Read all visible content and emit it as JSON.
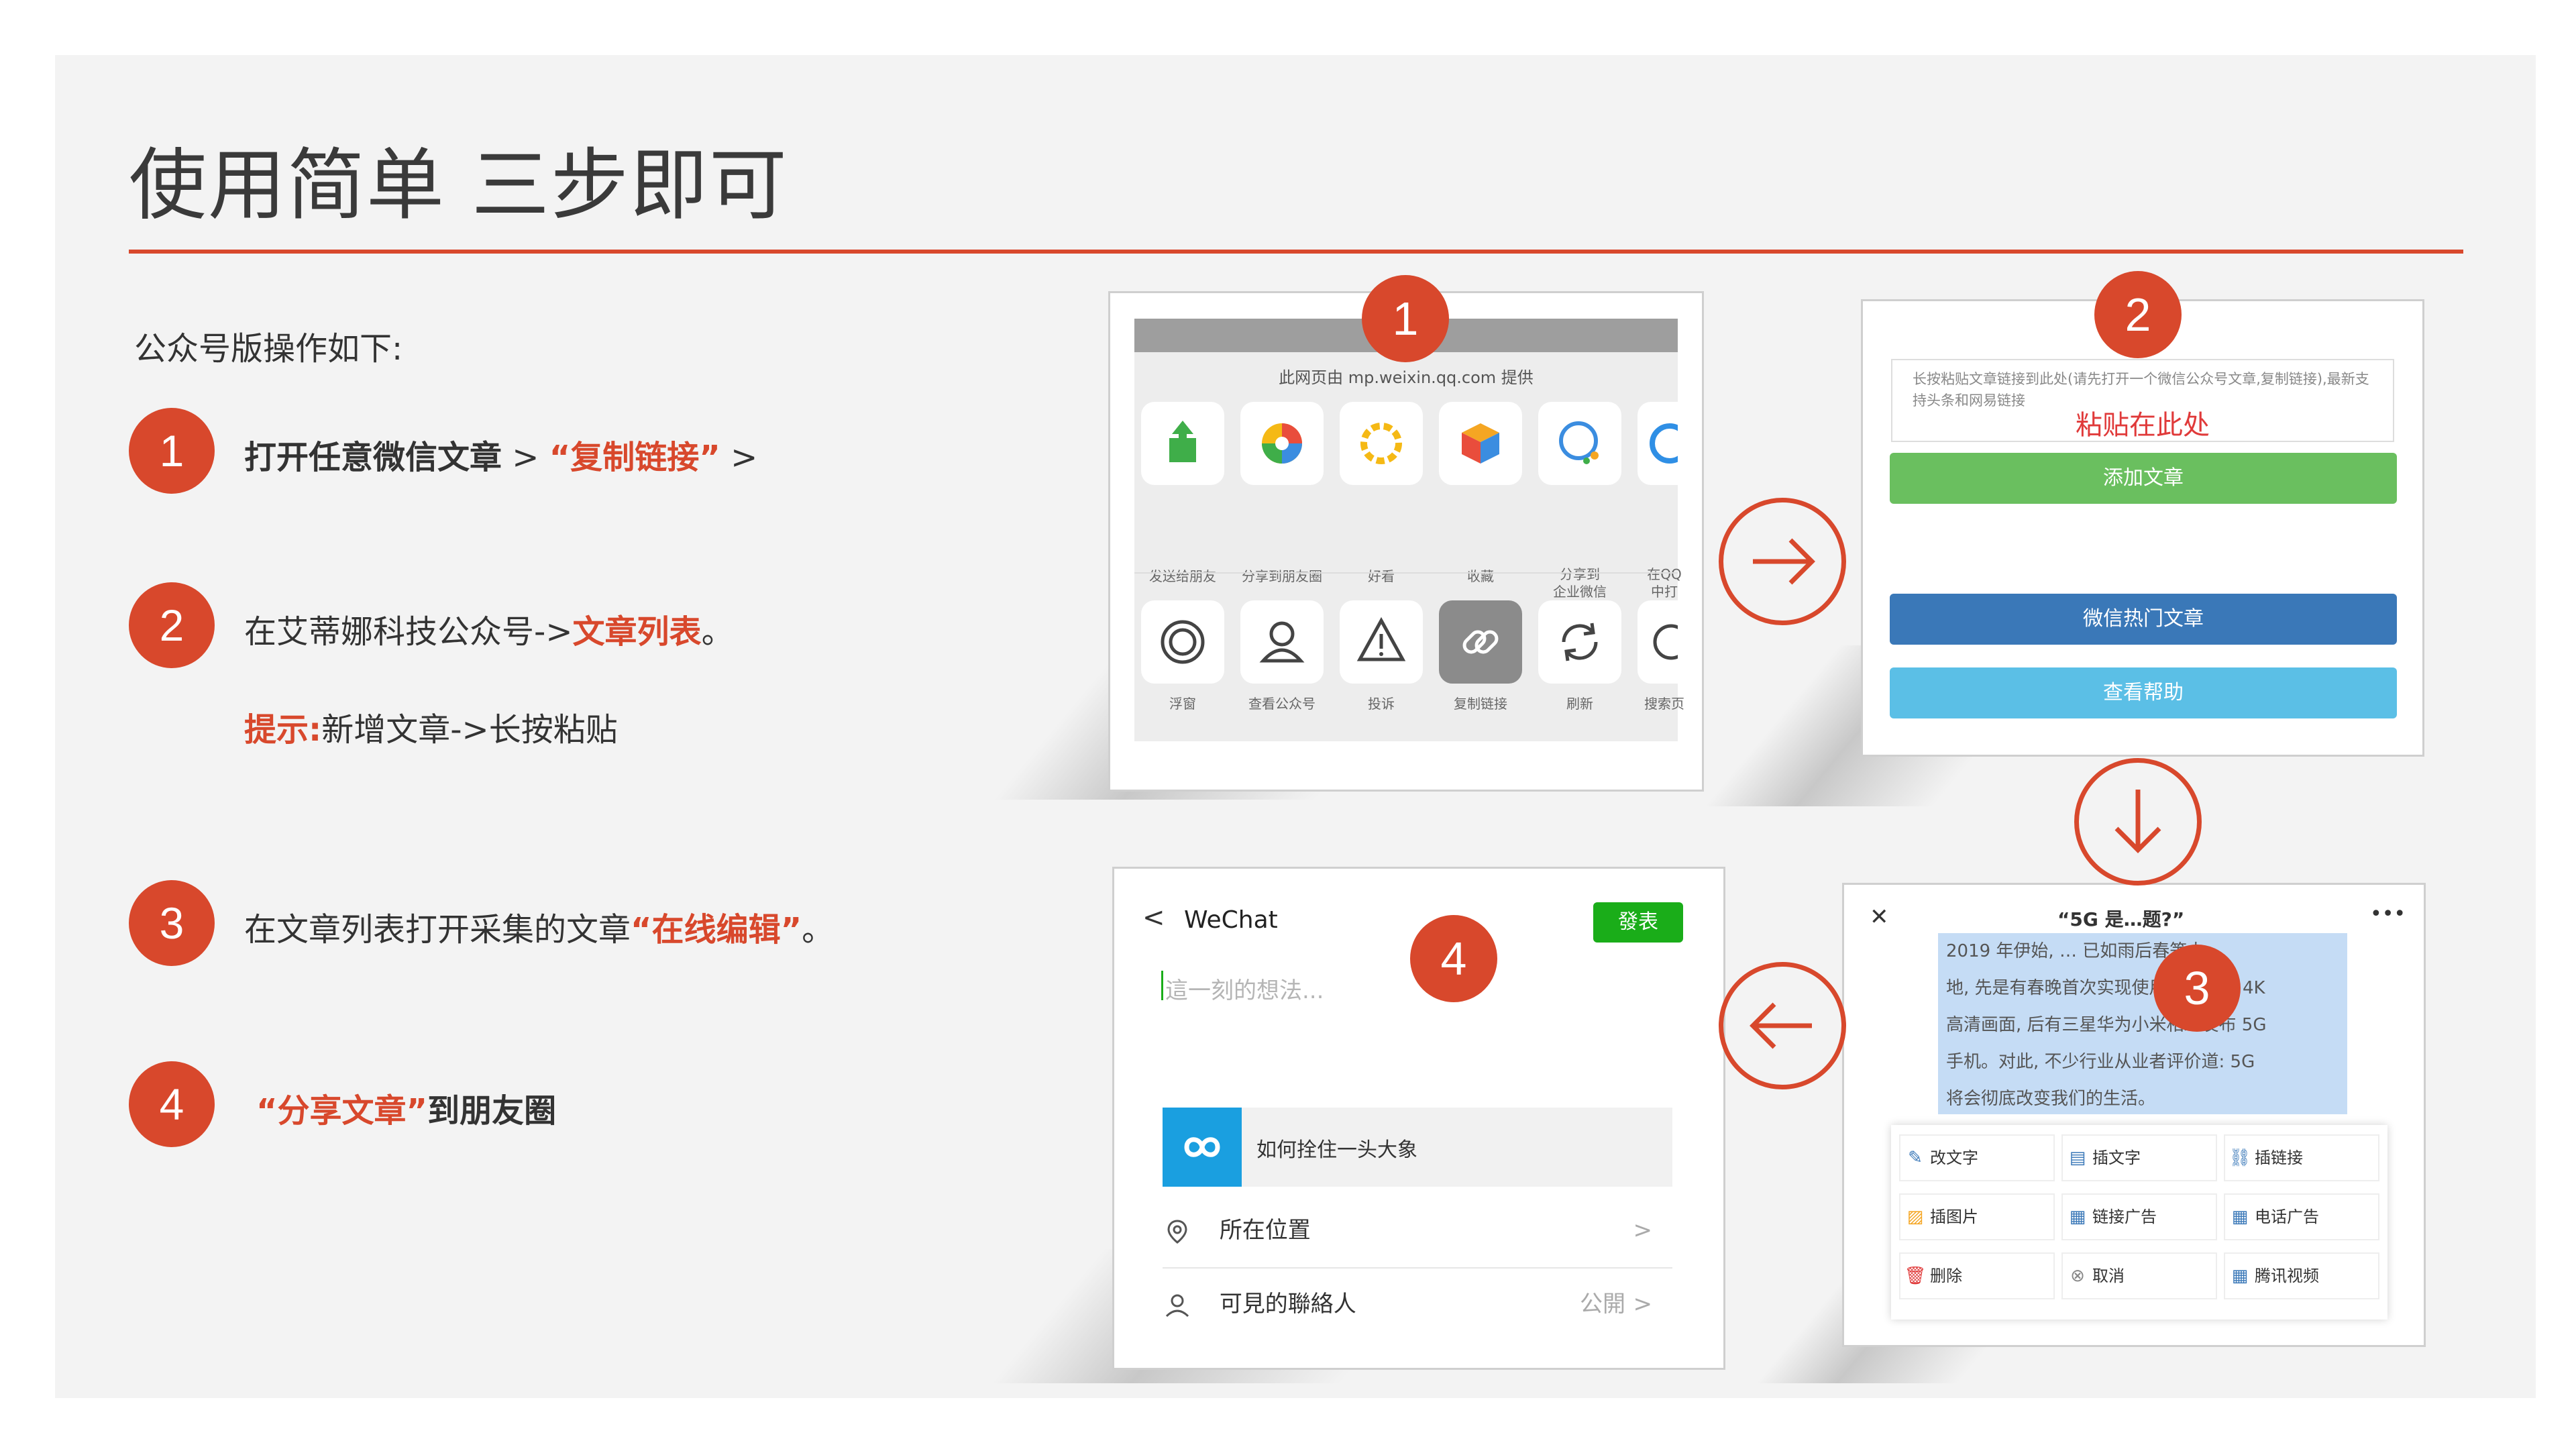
{
  "title": "使用简单 三步即可",
  "intro": "公众号版操作如下:",
  "steps": [
    {
      "num": "1",
      "a": "打开任意微信文章",
      "b": " > ",
      "c": "“复制链接”",
      "d": " >"
    },
    {
      "num": "2",
      "a": "在艾蒂娜科技公众号->",
      "b": "文章列表",
      "c": "。"
    },
    {
      "num": "3",
      "a": "在文章列表打开采集的文章",
      "b": "“在线编辑”",
      "c": "。"
    },
    {
      "num": "4",
      "a": "“分享文章”",
      "b": "到朋友圈"
    }
  ],
  "tip": {
    "label": "提示:",
    "text": "新增文章->长按粘贴"
  },
  "card1": {
    "badge": "1",
    "source": "此网页由 mp.weixin.qq.com 提供",
    "row1": [
      "发送给朋友",
      "分享到朋友圈",
      "好看",
      "收藏",
      "分享到\n企业微信",
      "在QQ\n中打"
    ],
    "row2": [
      "浮窗",
      "查看公众号",
      "投诉",
      "复制链接",
      "刷新",
      "搜索页"
    ]
  },
  "card2": {
    "badge": "2",
    "hint": "长按粘贴文章链接到此处(请先打开一个微信公众号文章,复制链接),最新支持头条和网易链接",
    "paste": "粘贴在此处",
    "btn_add": "添加文章",
    "btn_hot": "微信热门文章",
    "btn_help": "查看帮助",
    "colors": {
      "green": "#6abf5f",
      "blue": "#3a78b8",
      "lightblue": "#5bbfe6"
    }
  },
  "card3": {
    "badge": "3",
    "close": "✕",
    "header_title": "“5G 是…题?”",
    "more": "•••",
    "lines": [
      "2019 年伊始, … 已如雨后春笋大",
      "地, 先是有春晚首次实现使用 5G 传输 4K",
      "高清画面, 后有三星华为小米相继发布 5G",
      "手机。对此, 不少行业从业者评价道: 5G",
      "将会彻底改变我们的生活。"
    ],
    "menu": [
      {
        "icon": "✎",
        "label": "改文字"
      },
      {
        "icon": "▤",
        "label": "插文字"
      },
      {
        "icon": "⛓",
        "label": "插链接"
      },
      {
        "icon": "▨",
        "label": "插图片"
      },
      {
        "icon": "▦",
        "label": "链接广告"
      },
      {
        "icon": "▦",
        "label": "电话广告"
      },
      {
        "icon": "🗑",
        "label": "删除"
      },
      {
        "icon": "⊗",
        "label": "取消"
      },
      {
        "icon": "▦",
        "label": "腾讯视频"
      }
    ]
  },
  "card4": {
    "badge": "4",
    "back": "<",
    "app": "WeChat",
    "publish": "發表",
    "placeholder": "這一刻的想法...",
    "link_title": "如何拴住一头大象",
    "location": "所在位置",
    "visible": "可見的聯絡人",
    "visible_value": "公開",
    "chev": ">"
  }
}
